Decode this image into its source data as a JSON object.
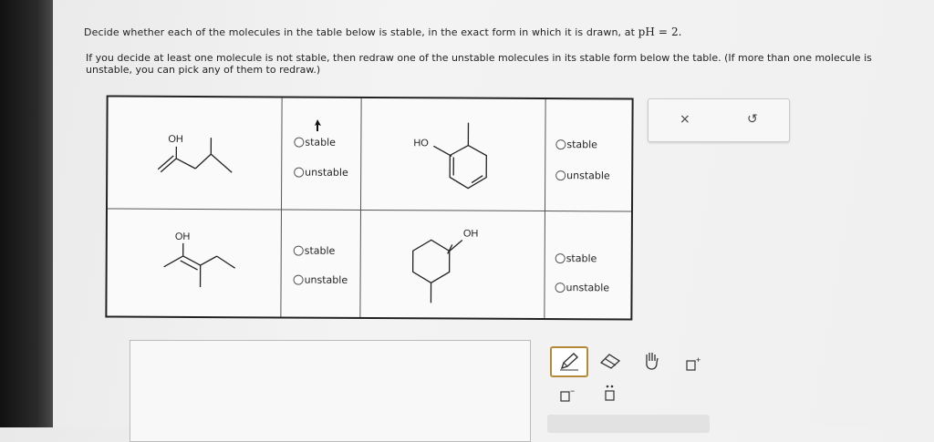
{
  "question": {
    "line1": "Decide whether each of the molecules in the table below is stable, in the exact form in which it is drawn, at ",
    "ph_value": "pH = 2.",
    "line2": "If you decide at least one molecule is not stable, then redraw one of the unstable molecules in its stable form below the table. (If more than one molecule is unstable, you can pick any of them to redraw.)"
  },
  "table": {
    "rows": [
      [
        {
          "label": "OH",
          "options": [
            "stable",
            "unstable"
          ]
        },
        {
          "label": "HO",
          "options": [
            "stable",
            "unstable"
          ]
        }
      ],
      [
        {
          "label": "OH",
          "options": [
            "stable",
            "unstable"
          ]
        },
        {
          "label": "OH",
          "options": [
            "stable",
            "unstable"
          ]
        }
      ]
    ]
  },
  "panel": {
    "close_symbol": "×",
    "undo_symbol": "↺"
  },
  "tools": {
    "names": [
      "pencil-icon",
      "eraser-icon",
      "hand-icon",
      "add-charge-icon",
      "remove-charge-icon",
      "lone-pair-icon"
    ],
    "plus": "+",
    "minus": "−"
  }
}
